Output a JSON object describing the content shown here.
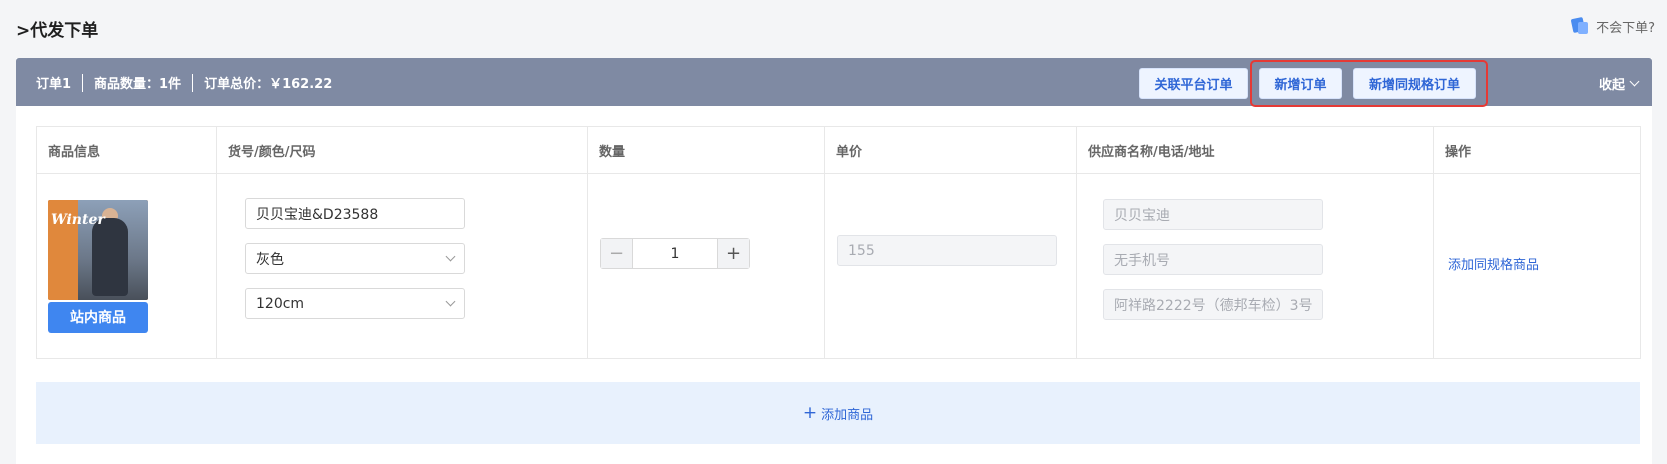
{
  "page": {
    "title": ">代发下单",
    "help_label": "不会下单?"
  },
  "order_bar": {
    "order_label": "订单1",
    "quantity_label": "商品数量：1件",
    "total_label": "订单总价：￥162.22",
    "link_platform_label": "关联平台订单",
    "new_order_label": "新增订单",
    "new_same_spec_label": "新增同规格订单",
    "collapse_label": "收起"
  },
  "table": {
    "headers": [
      "商品信息",
      "货号/颜色/尺码",
      "数量",
      "单价",
      "供应商名称/电话/地址",
      "操作"
    ],
    "row": {
      "thumb_text": "Winter",
      "in_site_label": "站内商品",
      "sku": "贝贝宝迪&D23588",
      "color": "灰色",
      "size": "120cm",
      "quantity": "1",
      "unit_price": "155",
      "supplier_name": "贝贝宝迪",
      "supplier_phone": "无手机号",
      "supplier_address": "阿祥路2222号（德邦车检）3号",
      "action_label": "添加同规格商品"
    }
  },
  "add_product_label": "添加商品",
  "colors": {
    "order_bar": "#7f8aa3",
    "accent": "#2f66d6",
    "primary_button": "#3f86f0",
    "highlight": "#e53935"
  }
}
